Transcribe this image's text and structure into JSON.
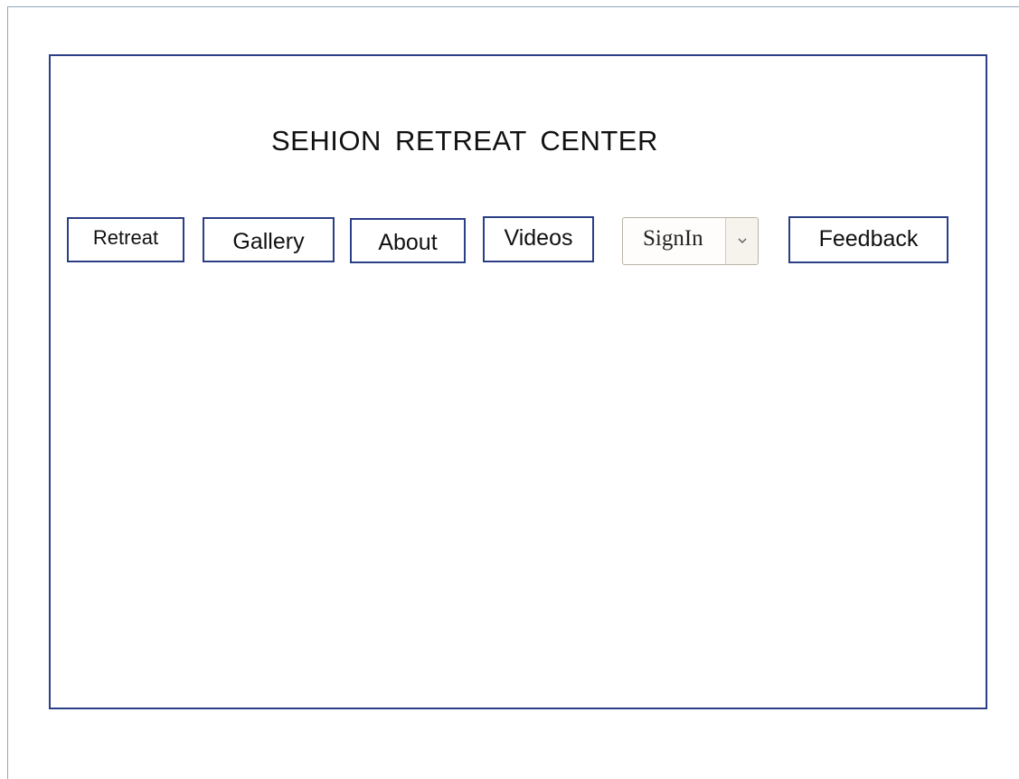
{
  "header": {
    "title": "SEHION RETREAT CENTER"
  },
  "nav": {
    "retreat": "Retreat",
    "gallery": "Gallery",
    "about": "About",
    "videos": "Videos",
    "signin": {
      "selected": "SignIn",
      "icon": "chevron-down-icon"
    },
    "feedback": "Feedback"
  },
  "colors": {
    "frame_border": "#2b3f86",
    "outer_border": "#8fa6b8",
    "select_border": "#b9b3a3"
  }
}
